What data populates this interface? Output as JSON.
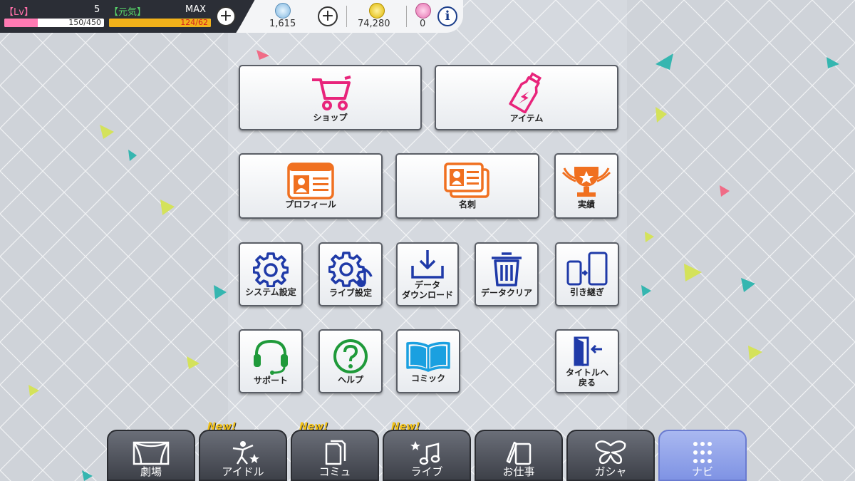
{
  "status": {
    "lv_label": "【Lv】",
    "lv_value": "5",
    "lv_exp_text": "150/450",
    "lv_exp_fraction": 0.333,
    "genki_label": "【元気】",
    "genki_max_label": "MAX",
    "genki_text": "124/62",
    "genki_fraction": 1.0,
    "jewels": "1,615",
    "coins": "74,280",
    "tickets": "0",
    "colors": {
      "exp": "#ff7ab3",
      "genki": "#f2b21a",
      "genki_text": "#d42020"
    }
  },
  "menu": {
    "shop": "ショップ",
    "item": "アイテム",
    "profile": "プロフィール",
    "card": "名刺",
    "achievement": "実績",
    "system_settings": "システム設定",
    "live_settings": "ライブ設定",
    "data_download": "データ\nダウンロード",
    "data_clear": "データクリア",
    "transfer": "引き継ぎ",
    "support": "サポート",
    "help": "ヘルプ",
    "comic": "コミック",
    "return_title": "タイトルへ\n戻る"
  },
  "nav": {
    "new_label": "New!",
    "theater": "劇場",
    "idol": "アイドル",
    "commu": "コミュ",
    "live": "ライブ",
    "work": "お仕事",
    "gacha": "ガシャ",
    "navi": "ナビ"
  },
  "icons": [
    "cart-icon",
    "bottle-icon",
    "profile-card-icon",
    "business-card-icon",
    "trophy-icon",
    "gear-icon",
    "gear-music-icon",
    "download-icon",
    "trash-icon",
    "transfer-phones-icon",
    "headset-icon",
    "help-icon",
    "book-icon",
    "exit-door-icon",
    "theater-icon",
    "idol-icon",
    "commu-icon",
    "live-icon",
    "work-icon",
    "gacha-icon",
    "navi-grid-icon"
  ]
}
